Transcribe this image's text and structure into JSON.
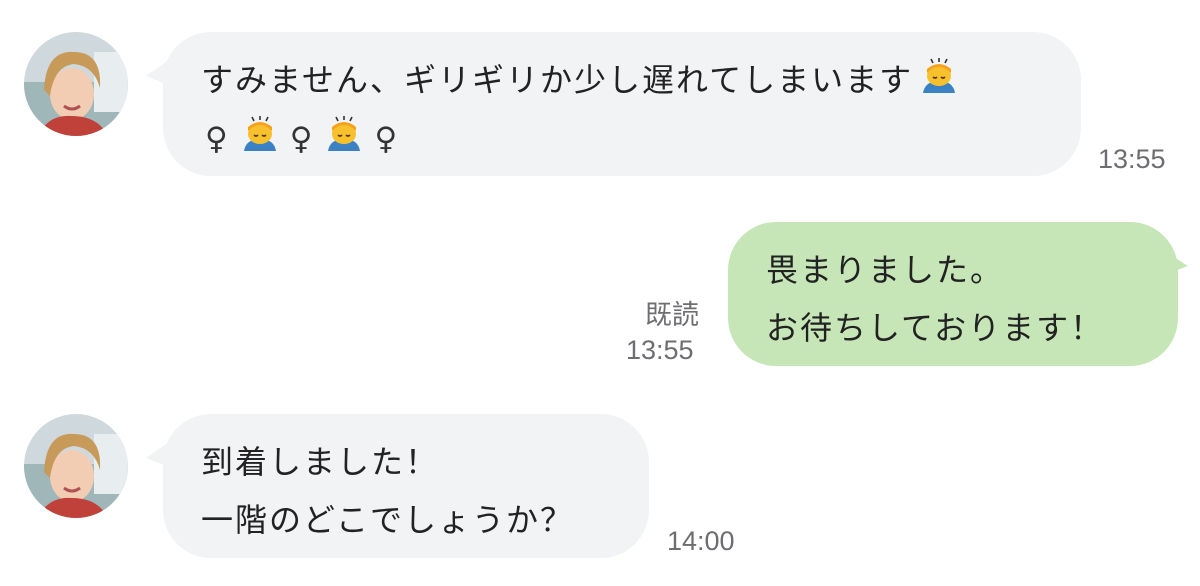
{
  "chat": {
    "messages": [
      {
        "direction": "incoming",
        "text_line1": "すみません、ギリギリか少し遅れてしまいます",
        "time": "13:55"
      },
      {
        "direction": "outgoing",
        "text_line1": "畏まりました。",
        "text_line2": "お待ちしております！",
        "read_label": "既読",
        "time": "13:55"
      },
      {
        "direction": "incoming",
        "text_line1": "到着しました！",
        "text_line2": "一階のどこでしょうか？",
        "time": "14:00"
      }
    ],
    "emoji": {
      "bowing_icon": "person-bowing-icon",
      "female_sign": "♀"
    },
    "colors": {
      "incoming_bubble": "#f2f3f5",
      "outgoing_bubble": "#c6e6b8",
      "meta_text": "#6e6e72"
    }
  }
}
